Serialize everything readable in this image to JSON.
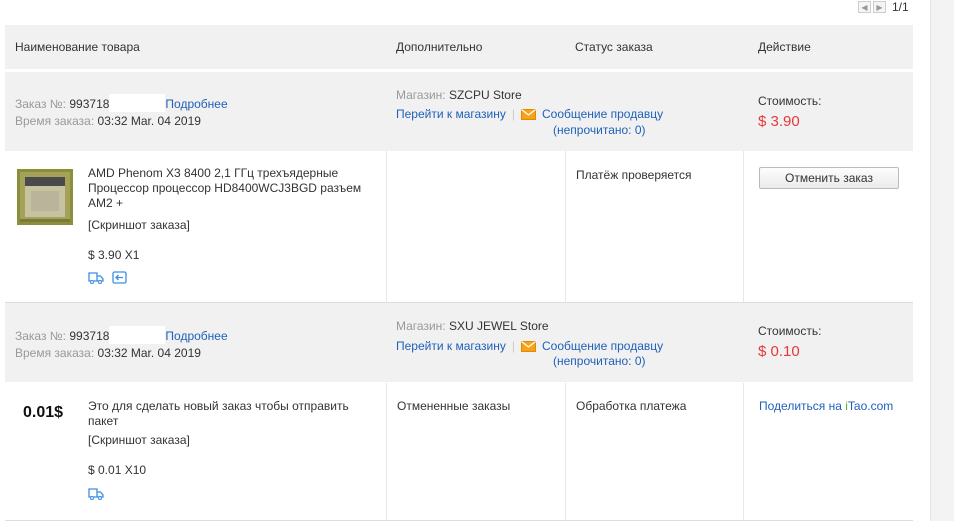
{
  "pager": {
    "prev_icon": "chevron-left-icon",
    "next_icon": "chevron-right-icon",
    "text": "1/1"
  },
  "header": {
    "product": "Наименование товара",
    "extra": "Дополнительно",
    "status": "Статус заказа",
    "action": "Действие"
  },
  "orders": [
    {
      "order_label": "Заказ №:",
      "order_number": "993718",
      "details_link": "Подробнее",
      "time_label": "Время заказа:",
      "time_value": "03:32 Mar. 04 2019",
      "store_label": "Магазин:",
      "store_name": "SZCPU Store",
      "go_to_store": "Перейти к магазину",
      "separator": "|",
      "message_seller": "Сообщение продавцу",
      "unread_text": "(непрочитано: 0)",
      "cost_label": "Стоимость:",
      "cost_value": "$ 3.90",
      "item_title": "AMD Phenom X3 8400 2,1 ГГц трехъядерные Процессор процессор HD8400WCJ3BGD разъем AM2 +",
      "screenshot_link": "[Скриншот заказа]",
      "price_qty": "$ 3.90 X1",
      "extra_text": "",
      "status_text": "Платёж проверяется",
      "action_button": "Отменить заказ",
      "icons": [
        "truck-icon",
        "return-icon"
      ]
    },
    {
      "order_label": "Заказ №:",
      "order_number": "993718",
      "details_link": "Подробнее",
      "time_label": "Время заказа:",
      "time_value": "03:32 Mar. 04 2019",
      "store_label": "Магазин:",
      "store_name": "SXU JEWEL Store",
      "go_to_store": "Перейти к магазину",
      "separator": "|",
      "message_seller": "Сообщение продавцу",
      "unread_text": "(непрочитано: 0)",
      "cost_label": "Стоимость:",
      "cost_value": "$ 0.10",
      "item_title": "Это для сделать новый заказ чтобы отправить пакет",
      "item_thumb_text": "0.01$",
      "screenshot_link": "[Скриншот заказа]",
      "price_qty": "$ 0.01 X10",
      "extra_text": "Отмененные заказы",
      "status_text": "Обработка платежа",
      "share_text": "Поделиться на",
      "share_brand": "iTao.com",
      "icons": [
        "truck-icon"
      ]
    }
  ]
}
